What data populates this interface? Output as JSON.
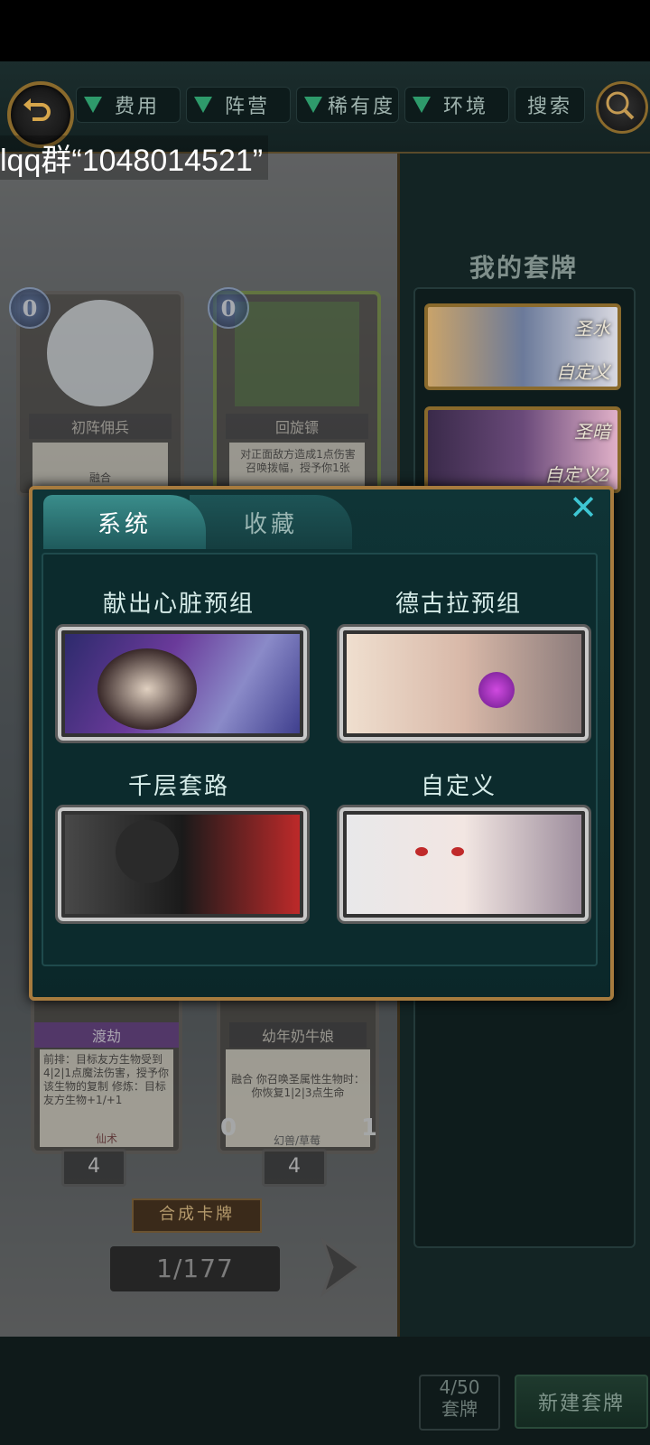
{
  "overlay_text": "lqq群“1048014521”",
  "filters": [
    "费用",
    "阵营",
    "稀有度",
    "环境",
    "搜索"
  ],
  "right_panel": {
    "title": "我的套牌",
    "decks": [
      {
        "tag": "圣水",
        "name": "自定义"
      },
      {
        "tag": "圣暗",
        "name": "自定义2"
      }
    ],
    "count_top": "4/50",
    "count_bottom": "套牌",
    "new_deck": "新建套牌"
  },
  "cards": [
    {
      "cost": "0",
      "name": "初阵佣兵",
      "text": "融合"
    },
    {
      "cost": "0",
      "name": "回旋镖",
      "text": "对正面敌方造成1点伤害 召唤拨幅，授予你1张"
    },
    {
      "cost": "",
      "name": "渡劫",
      "text": "前排：目标友方生物受到4|2|1点魔法伤害，授予你该生物的复制 修炼：目标友方生物+1/+1",
      "type": "仙术",
      "count": "4"
    },
    {
      "cost": "",
      "name": "幼年奶牛娘",
      "text": "融合 你召唤圣属性生物时：你恢复1|2|3点生命",
      "type": "幻兽/草莓",
      "count": "4",
      "atk": "0",
      "hp": "1"
    }
  ],
  "craft_button": "合成卡牌",
  "pagination": "1/177",
  "modal": {
    "tabs": [
      "系统",
      "收藏"
    ],
    "close": "✕",
    "decks": [
      {
        "label": "献出心脏预组"
      },
      {
        "label": "德古拉预组"
      },
      {
        "label": "千层套路"
      },
      {
        "label": "自定义"
      }
    ]
  },
  "icons": {
    "back": "back-arrow-icon",
    "search": "magnifier-icon",
    "filter": "triangle-down-icon",
    "next": "next-arrow-icon",
    "close": "close-icon"
  },
  "colors": {
    "accent_teal": "#3ec6d3",
    "frame_gold": "#a77b3e",
    "filter_green": "#2e9a6b"
  }
}
